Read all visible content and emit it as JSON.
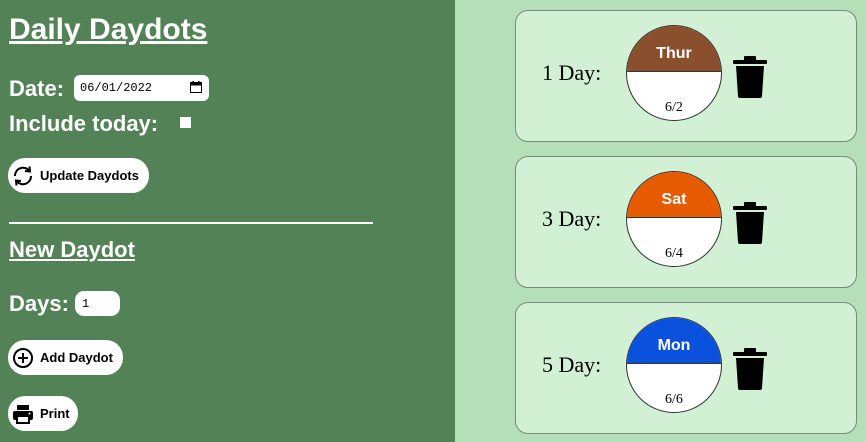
{
  "sidebar": {
    "title": "Daily Daydots",
    "date_label": "Date:",
    "date_value": "06/01/2022",
    "include_today_label": "Include today:",
    "update_button": "Update Daydots",
    "new_section_title": "New Daydot",
    "days_label": "Days:",
    "days_value": "1",
    "add_button": "Add Daydot",
    "print_button": "Print"
  },
  "daydots": [
    {
      "label": "1 Day:",
      "weekday": "Thur",
      "date": "6/2",
      "color": "#8a4f2d"
    },
    {
      "label": "3 Day:",
      "weekday": "Sat",
      "date": "6/4",
      "color": "#e65a00"
    },
    {
      "label": "5 Day:",
      "weekday": "Mon",
      "date": "6/6",
      "color": "#0a52dd"
    }
  ],
  "colors": {
    "sidebar_bg": "#538256",
    "main_bg": "#b4dfb8",
    "card_bg": "#d1f0d4"
  }
}
